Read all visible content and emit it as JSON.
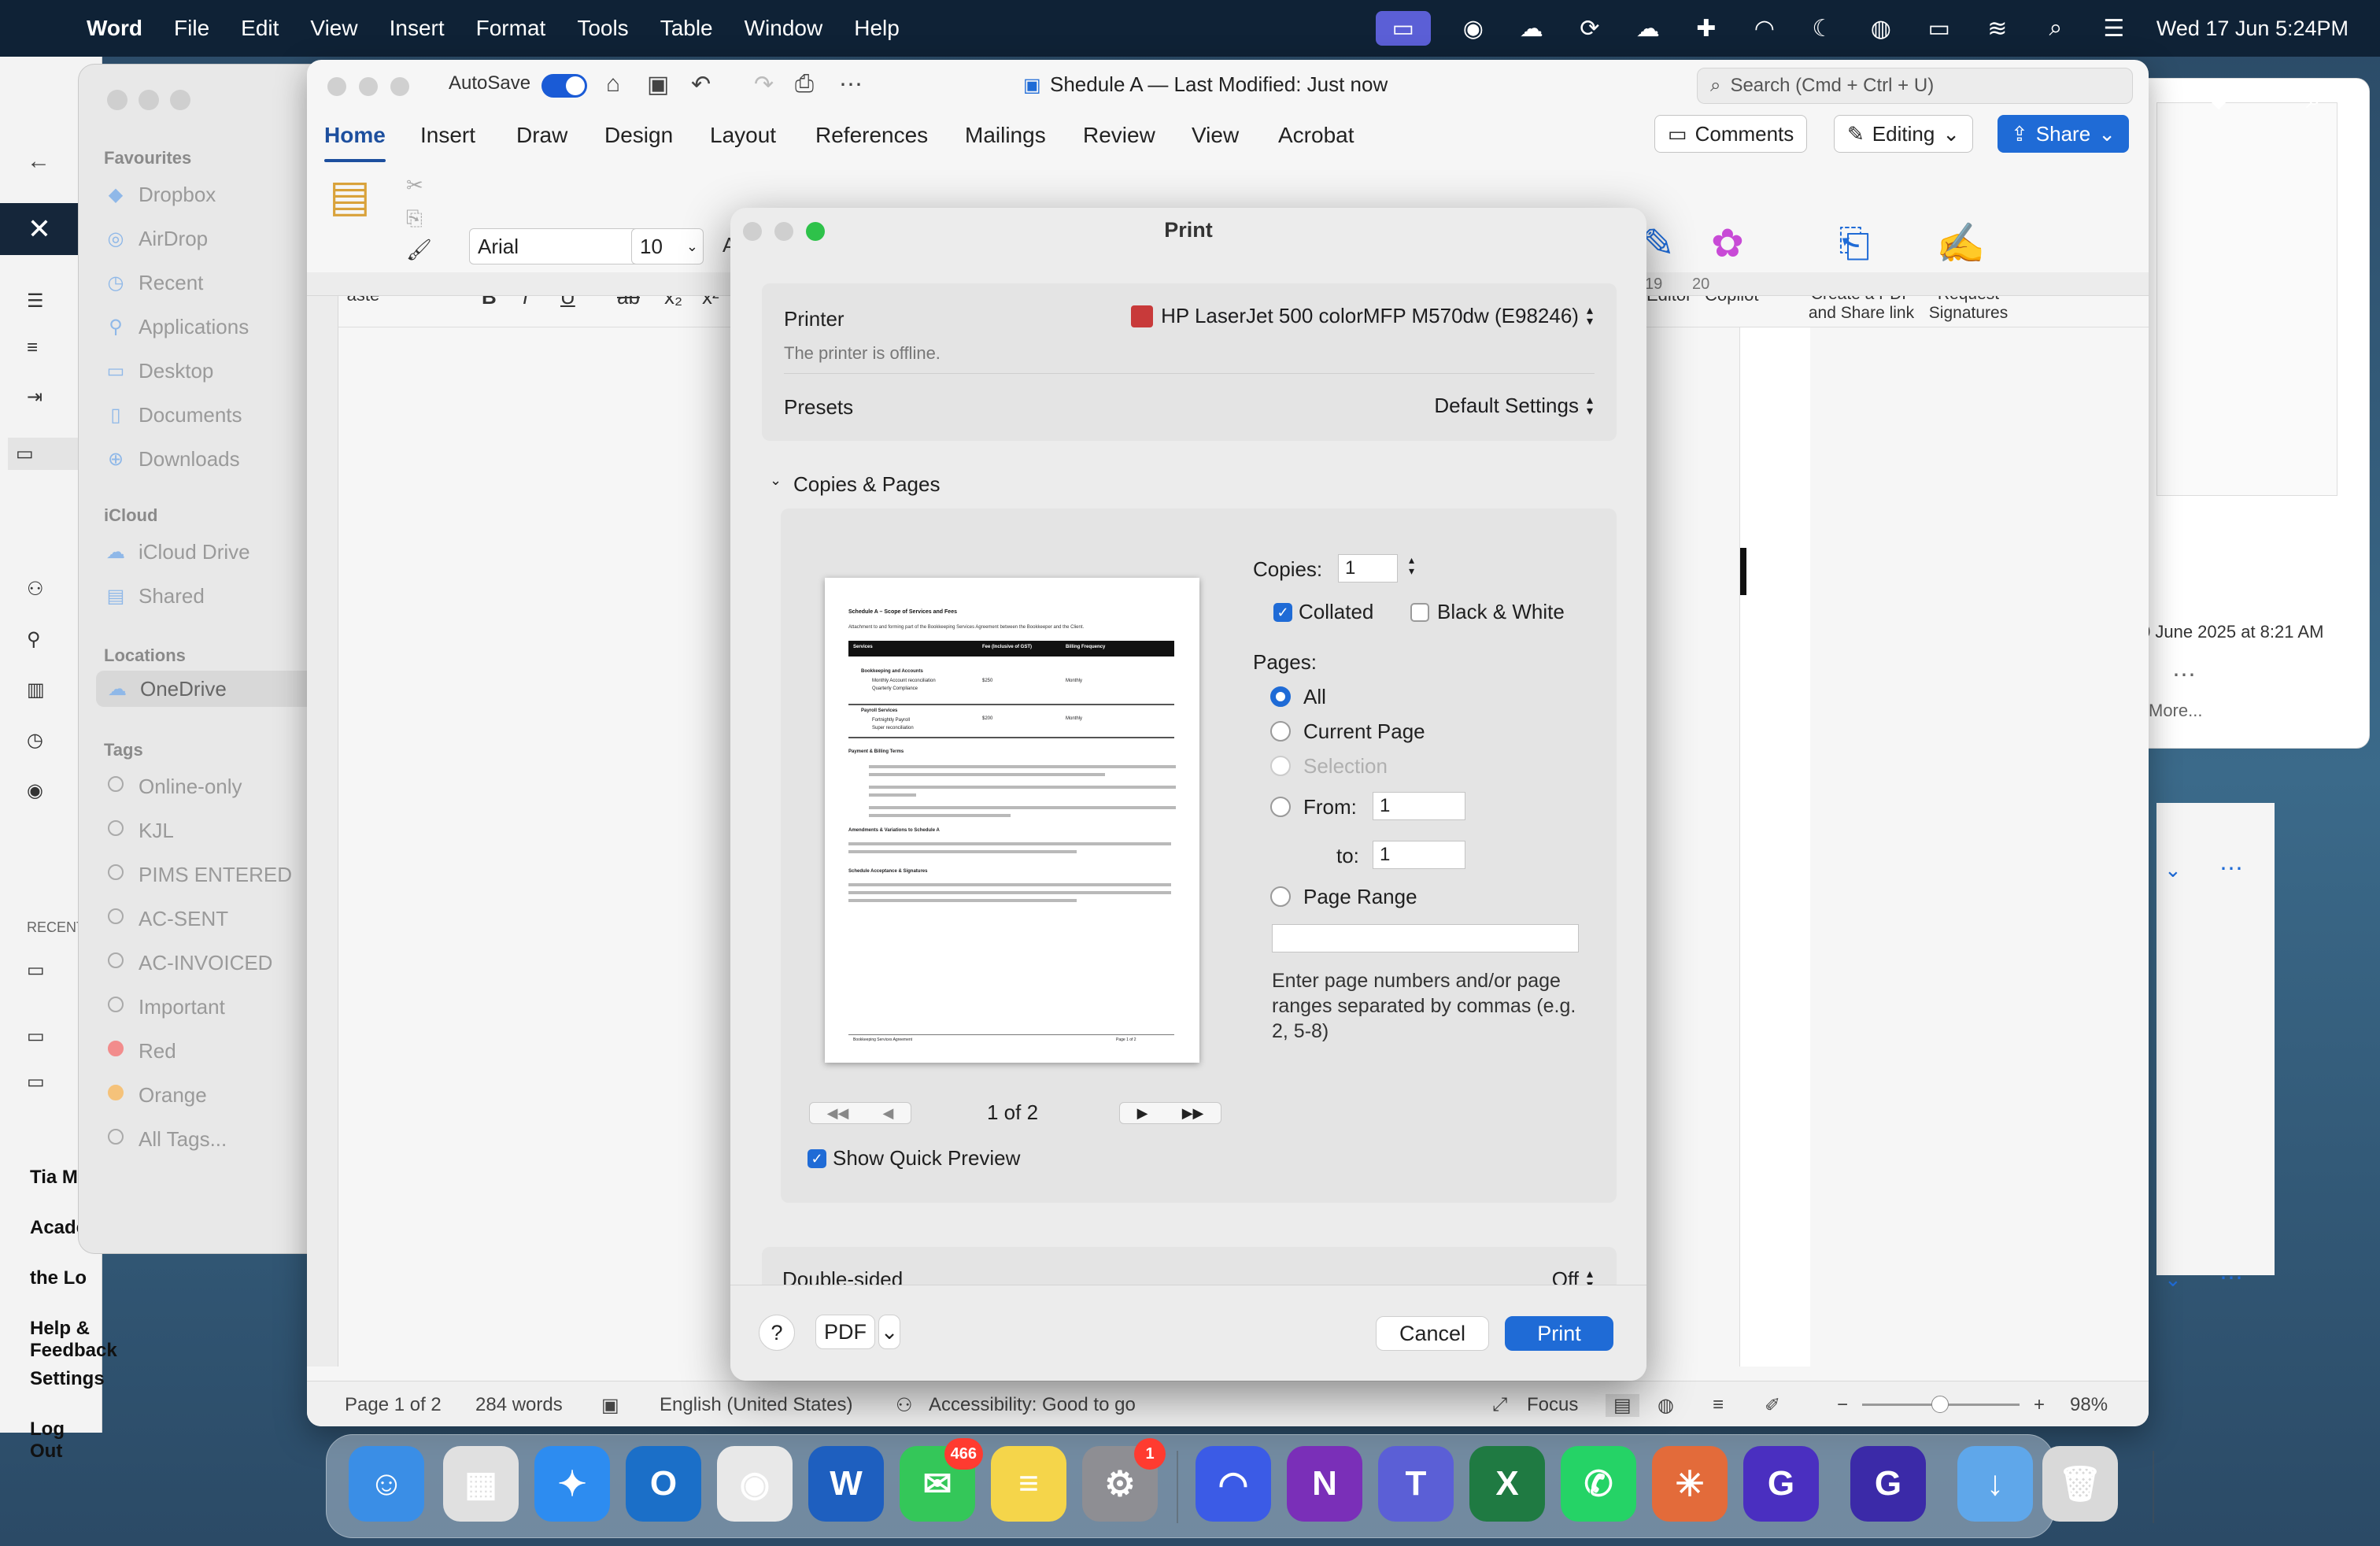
{
  "menubar": {
    "app_name": "Word",
    "items": [
      "File",
      "Edit",
      "View",
      "Insert",
      "Format",
      "Tools",
      "Table",
      "Window",
      "Help"
    ],
    "clock": "Wed 17 Jun  5:24PM"
  },
  "finder": {
    "favourites_header": "Favourites",
    "favourites": [
      "Dropbox",
      "AirDrop",
      "Recent",
      "Applications",
      "Desktop",
      "Documents",
      "Downloads"
    ],
    "icloud_header": "iCloud",
    "icloud": [
      "iCloud Drive",
      "Shared"
    ],
    "locations_header": "Locations",
    "locations": [
      "OneDrive"
    ],
    "tags_header": "Tags",
    "tags": [
      "Online-only",
      "KJL",
      "PIMS ENTERED",
      "AC-SENT",
      "AC-INVOICED",
      "Important",
      "Red",
      "Orange",
      "All Tags..."
    ]
  },
  "bg_left": {
    "recent_label": "RECENT",
    "sidebar": [
      "Tia Ml",
      "Acade",
      "the Lo",
      "Help & Feedback",
      "Settings",
      "Log Out"
    ]
  },
  "bg_right": {
    "date_text": "0 June 2025 at 8:21 AM",
    "more_label": "More..."
  },
  "word": {
    "autosave_label": "AutoSave",
    "doc_title": "Shedule A  — Last Modified: Just now",
    "search_placeholder": "Search (Cmd + Ctrl + U)",
    "tabs": [
      "Home",
      "Insert",
      "Draw",
      "Design",
      "Layout",
      "References",
      "Mailings",
      "Review",
      "View",
      "Acrobat"
    ],
    "comments_label": "Comments",
    "editing_label": "Editing",
    "share_label": "Share",
    "paste_label": "Paste",
    "font_name": "Arial",
    "font_size": "10",
    "editor_label": "Editor",
    "copilot_label": "Copilot",
    "create_pdf_label_1": "Create a PDF",
    "create_pdf_label_2": "and Share link",
    "request_sig_label_1": "Request",
    "request_sig_label_2": "Signatures",
    "ruler_marks": [
      "19",
      "20"
    ],
    "status": {
      "page": "Page 1 of 2",
      "words": "284 words",
      "language": "English (United States)",
      "accessibility": "Accessibility: Good to go",
      "focus": "Focus",
      "zoom": "98%"
    }
  },
  "print_dialog": {
    "title": "Print",
    "printer_label": "Printer",
    "printer_value": "HP LaserJet 500 colorMFP M570dw (E98246)",
    "printer_status": "The printer is offline.",
    "presets_label": "Presets",
    "presets_value": "Default Settings",
    "section_label": "Copies & Pages",
    "copies_label": "Copies:",
    "copies_value": "1",
    "collated_label": "Collated",
    "bw_label": "Black & White",
    "pages_label": "Pages:",
    "opt_all": "All",
    "opt_current": "Current Page",
    "opt_selection": "Selection",
    "opt_from": "From:",
    "from_value": "1",
    "to_label": "to:",
    "to_value": "1",
    "opt_range": "Page Range",
    "range_hint": "Enter page numbers and/or page ranges separated by commas (e.g. 2, 5-8)",
    "page_indicator": "1 of 2",
    "quick_preview_label": "Show Quick Preview",
    "double_sided_label": "Double-sided",
    "double_sided_value": "Off",
    "help_label": "?",
    "pdf_label": "PDF",
    "cancel_label": "Cancel",
    "print_label": "Print",
    "preview": {
      "heading": "Schedule A – Scope of Services and Fees",
      "intro": "Attachment to and forming part of the Bookkeeping Services Agreement between the Bookkeeper and the Client.",
      "table_headers": [
        "Services",
        "Fee (Inclusive of GST)",
        "Billing Frequency"
      ],
      "row1_title": "Bookkeeping and Accounts",
      "row1_items": [
        "Monthly Account reconciliation",
        "Quarterly Compliance"
      ],
      "row1_fee": "$250",
      "row1_freq": "Monthly",
      "row2_title": "Payroll Services",
      "row2_items": [
        "Fortnightly Payroll",
        "Super reconciliation"
      ],
      "row2_fee": "$200",
      "row2_freq": "Monthly",
      "sec1": "Payment & Billing Terms",
      "sec2": "Amendments & Variations to Schedule A",
      "sec3": "Schedule Acceptance & Signatures",
      "footer_left": "Bookkeeping Services Agreement",
      "footer_right": "Page 1 of 2"
    }
  },
  "dock": {
    "apps": [
      {
        "name": "finder",
        "color": "#3a8ee6",
        "glyph": "☺"
      },
      {
        "name": "launchpad",
        "color": "#e0e0e0",
        "glyph": "▦"
      },
      {
        "name": "safari",
        "color": "#2d8cf0",
        "glyph": "✦"
      },
      {
        "name": "outlook",
        "color": "#1b6fc8",
        "glyph": "O"
      },
      {
        "name": "chrome",
        "color": "#e8e8e8",
        "glyph": "◉"
      },
      {
        "name": "word",
        "color": "#1e5fbf",
        "glyph": "W"
      },
      {
        "name": "messages",
        "color": "#34c759",
        "glyph": "✉",
        "badge": "466"
      },
      {
        "name": "notes",
        "color": "#f5d54a",
        "glyph": "≡"
      },
      {
        "name": "system-settings",
        "color": "#8e8e93",
        "glyph": "⚙",
        "badge": "1"
      },
      {
        "name": "arc",
        "color": "#3b5be6",
        "glyph": "◠"
      },
      {
        "name": "onenote",
        "color": "#7a2fb8",
        "glyph": "N"
      },
      {
        "name": "teams",
        "color": "#5b5fd6",
        "glyph": "T"
      },
      {
        "name": "excel",
        "color": "#1f7a42",
        "glyph": "X"
      },
      {
        "name": "whatsapp",
        "color": "#25d366",
        "glyph": "✆"
      },
      {
        "name": "claude",
        "color": "#e36b3a",
        "glyph": "✳"
      },
      {
        "name": "app-g",
        "color": "#4a2fc0",
        "glyph": "G"
      },
      {
        "name": "recent-app-g",
        "color": "#3b2aa8",
        "glyph": "G"
      },
      {
        "name": "downloads",
        "color": "#5fa7ea",
        "glyph": "↓"
      },
      {
        "name": "trash",
        "color": "#d9d9d9",
        "glyph": "🗑"
      }
    ]
  }
}
